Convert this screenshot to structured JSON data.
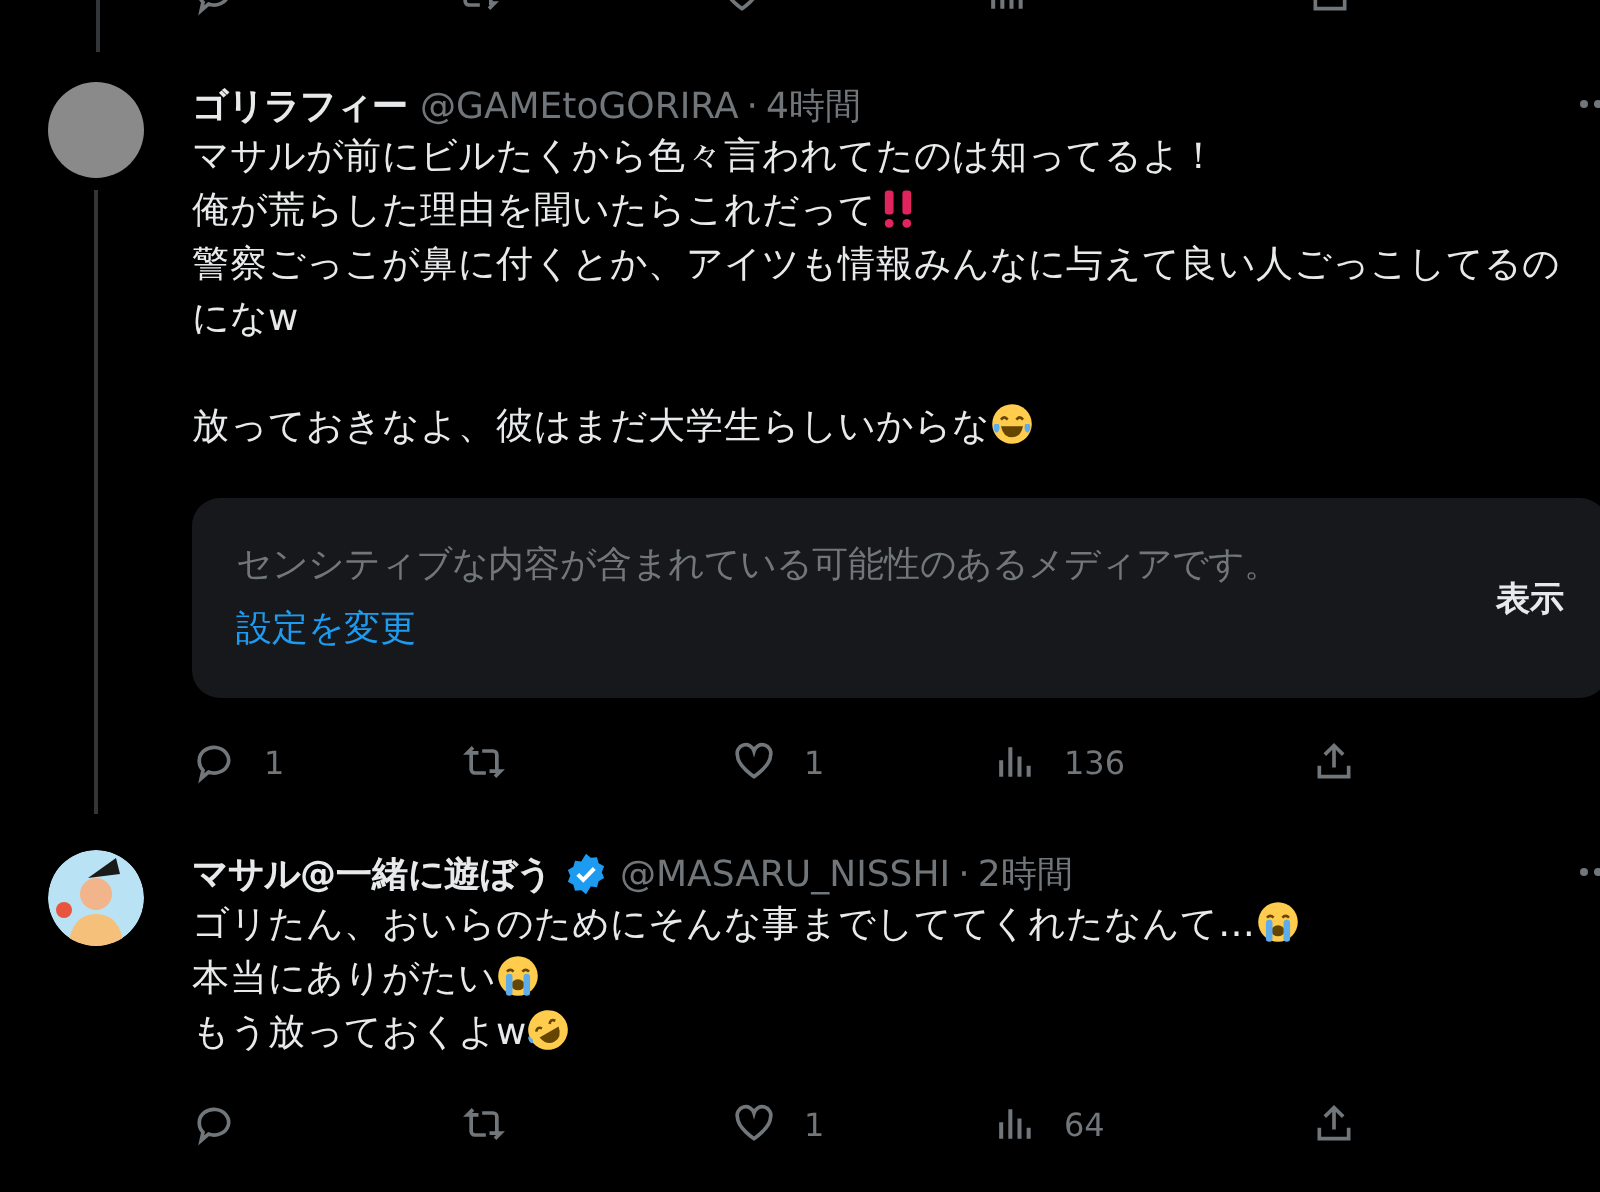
{
  "tweets": [
    {
      "name": "ゴリラフィー",
      "verified": false,
      "handle": "@GAMEtoGORIRA",
      "separator": "·",
      "time": "4時間",
      "paragraphs": [
        [
          {
            "kind": "plain",
            "text": "マサルが前にビルたくから色々言われてたのは知ってるよ！"
          },
          {
            "kind": "exclaim",
            "text": "俺が荒らした理由を聞いたらこれだって"
          },
          {
            "kind": "plain",
            "text": "警察ごっこが鼻に付くとか、アイツも情報みんなに与えて良い人ごっこしてるのになw"
          }
        ],
        [
          {
            "kind": "laughing",
            "text": "放っておきなよ、彼はまだ大学生らしいからな"
          }
        ]
      ],
      "media_warning": {
        "message": "センシティブな内容が含まれている可能性のあるメディアです。",
        "link": "設定を変更",
        "button": "表示"
      },
      "thread_below": true,
      "actions": [
        {
          "kind": "reply",
          "count": "1"
        },
        {
          "kind": "retweet"
        },
        {
          "kind": "like",
          "count": "1"
        },
        {
          "kind": "views",
          "count": "136"
        },
        {
          "kind": "share"
        }
      ]
    },
    {
      "name": "マサル@一緒に遊ぼう",
      "verified": true,
      "handle": "@MASARU_NISSHI",
      "separator": "·",
      "time": "2時間",
      "paragraphs": [
        [
          {
            "kind": "crying",
            "text": "ゴリたん、おいらのためにそんな事までしててくれたなんて…"
          },
          {
            "kind": "crying",
            "text": "本当にありがたい"
          },
          {
            "kind": "rolling",
            "text": "もう放っておくよw"
          }
        ]
      ],
      "thread_below": false,
      "actions": [
        {
          "kind": "reply"
        },
        {
          "kind": "retweet"
        },
        {
          "kind": "like",
          "count": "1"
        },
        {
          "kind": "views",
          "count": "64"
        },
        {
          "kind": "share"
        }
      ]
    }
  ]
}
